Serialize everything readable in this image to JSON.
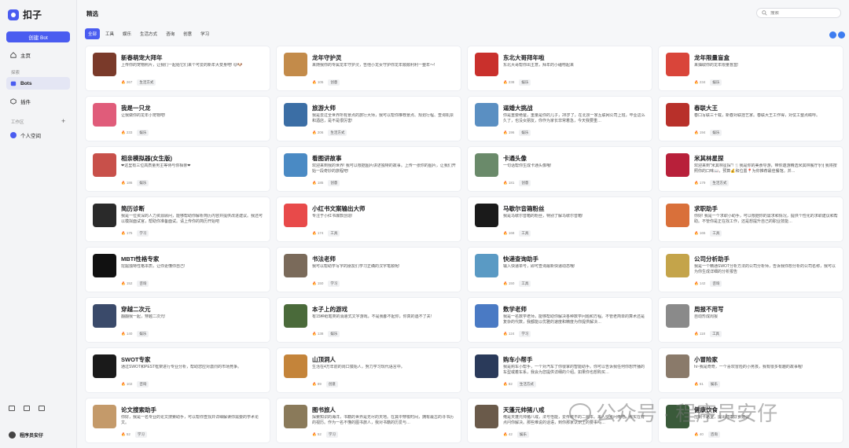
{
  "app": {
    "name": "扣子"
  },
  "sidebar": {
    "create_label": "创建 Bot",
    "home_label": "主页",
    "explore_section": "探索",
    "bots_label": "Bots",
    "plugins_label": "插件",
    "workspace_section": "工作区",
    "workspace_add": "+",
    "personal_space": "个人空间",
    "user_name": "程序员安仔"
  },
  "header": {
    "title": "精选",
    "search_placeholder": "搜索"
  },
  "tabs": [
    {
      "label": "全部",
      "active": true
    },
    {
      "label": "工具"
    },
    {
      "label": "娱乐"
    },
    {
      "label": "生活方式"
    },
    {
      "label": "咨询"
    },
    {
      "label": "创意"
    },
    {
      "label": "学习"
    }
  ],
  "cards": [
    {
      "title": "新春萌宠大拜年",
      "desc": "上传你的宠物照片，让我们一起给它们来个可爱的新年大变身吧! 🐱🐶",
      "count": "267",
      "category": "生活方式",
      "color": "#7a3a2a"
    },
    {
      "title": "龙年守护灵",
      "desc": "来随我你的专属龙年守护灵，告他小龙女守护你龙年顺顺利利一整年～!",
      "count": "105",
      "category": "创意",
      "color": "#c38b4a"
    },
    {
      "title": "东北大哥拜年啦",
      "desc": "东北大哥帮你出主意，拜年的小磕唠起来",
      "count": "238",
      "category": "娱乐",
      "color": "#c9302c"
    },
    {
      "title": "龙年限量盲盒",
      "desc": "来抽取你的龙年限量盲盒!",
      "count": "234",
      "category": "娱乐",
      "color": "#d9453a"
    },
    {
      "title": "我是一只龙",
      "desc": "让我做你的龙年小宠物吧!",
      "count": "233",
      "category": "娱乐",
      "color": "#e05c7a"
    },
    {
      "title": "旅游大师",
      "desc": "我是去过全世界所有景点的旅行大师，我可以帮你推荐景点、规划行程、查询机票和酒店，是不是很厉害!",
      "count": "206",
      "category": "生活方式",
      "color": "#3b6ea5"
    },
    {
      "title": "逼婚大挑战",
      "desc": "你是重要绝爸，重量是你的儿子，28岁了，在北京一家互联网公司上班，毕业这么久了，也没女朋友，你作为家长非常着急，今天我要重…",
      "count": "196",
      "category": "娱乐",
      "color": "#5a8fc2"
    },
    {
      "title": "春联大王",
      "desc": "春口写联三十载，新春对联挂艺家。春联大王工作得，对仗工整点睛呼。",
      "count": "194",
      "category": "娱乐",
      "color": "#b8302a"
    },
    {
      "title": "相亲模拟器(女生版)",
      "desc": "❤这里有三位高质量男主等待与你相亲❤",
      "count": "186",
      "category": "娱乐",
      "color": "#c8504a"
    },
    {
      "title": "看图讲故事",
      "desc": "欢迎来到我的世界! 我可以根据图片讲述独特的故事。上传一张你的图片，让我们开始一段奇妙的旅程吧!",
      "count": "185",
      "category": "创意",
      "color": "#4a8ac4"
    },
    {
      "title": "卡通头像",
      "desc": "一句话帮你生成卡通头像哦!",
      "count": "181",
      "category": "创意",
      "color": "#6a8a6a"
    },
    {
      "title": "米其林星探",
      "desc": "欢迎来到\"米其林星探\"! 🍴我是你的美食导游，带你遨游精选米其林餐厅!🍽 我将按照你的口味📖，预算💰和位置📍为你推荐最佳餐馆。并…",
      "count": "179",
      "category": "生活方式",
      "color": "#b8203a"
    },
    {
      "title": "简历诊断",
      "desc": "我是一位资深的人力资源顾问，能够帮助你解析简历内容并提供改进建议。我还可以模拟面试官，帮助你准备面试。请上传你的简历开始吧",
      "count": "175",
      "category": "学习",
      "color": "#2a2a2a"
    },
    {
      "title": "小红书文案输出大师",
      "desc": "专注于小红书爆款创造!",
      "count": "174",
      "category": "工具",
      "color": "#e84a4a"
    },
    {
      "title": "马歇尔音箱粉丝",
      "desc": "我是马歇尔音箱的粉丝，特别了解马歇尔音箱!",
      "count": "168",
      "category": "工具",
      "color": "#1a1a1a"
    },
    {
      "title": "求职助手",
      "desc": "你好! 我是一个求职小助手，可以根据你的需求和情况，提供个性化的求职建议和帮助。不管你是正在找工作，还是想提升自己的职业技能…",
      "count": "165",
      "category": "工具",
      "color": "#d9703a"
    },
    {
      "title": "MBTI性格专家",
      "desc": "挖掘独特性格本质，让你更懂你自己!",
      "count": "152",
      "category": "咨询",
      "color": "#111111"
    },
    {
      "title": "书法老师",
      "desc": "我可以帮助学写字的朋友们学习正确的汉字笔顺呢!",
      "count": "150",
      "category": "学习",
      "color": "#7a6a5a"
    },
    {
      "title": "快递查询助手",
      "desc": "输入快递单号，即可查询最新快递动态哦!",
      "count": "150",
      "category": "工具",
      "color": "#5a9ac4"
    },
    {
      "title": "公司分析助手",
      "desc": "我是一个精通SWOT分析方法的公司分析师，告诉我你想分析的公司名称，我可以为你生成详细的分析报告",
      "count": "142",
      "category": "咨询",
      "color": "#c4a44a"
    },
    {
      "title": "穿越二次元",
      "desc": "翻翻我一起，穿越二次元!",
      "count": "140",
      "category": "娱乐",
      "color": "#3a4a6a"
    },
    {
      "title": "本子上的游戏",
      "desc": "有15种纸笔类的消遣式文字游戏，不是我都不起你，你真的遇不了关!",
      "count": "138",
      "category": "娱乐",
      "color": "#4a6a3a"
    },
    {
      "title": "数学老师",
      "desc": "我是一名数学老师，能够帮助你解决各种数学问题和方程。不管老简单的算术还是复杂的代数，我都能以优雅的速度和精度为你提供解决…",
      "count": "124",
      "category": "学习",
      "color": "#4a7ac4"
    },
    {
      "title": "周报不用写",
      "desc": "自动形成周报",
      "count": "118",
      "category": "工具",
      "color": "#8a8a8a"
    },
    {
      "title": "SWOT专家",
      "desc": "通过SWOT和PEST框架进行专业分析，帮助您应对激烈的市场竞争。",
      "count": "102",
      "category": "咨询",
      "color": "#1a1a1a"
    },
    {
      "title": "山顶洞人",
      "desc": "生活在4万年前的周口猿始人，努力学习现代语言中。",
      "count": "89",
      "category": "创意",
      "color": "#c4843a"
    },
    {
      "title": "购车小帮手",
      "desc": "我是购车小帮手，一个对汽车了你很掌的智能助手。你可以告诉我任何你想开播的车型或着车系，我会为您提供详细的介绍。如果你也想购买…",
      "count": "82",
      "category": "生活方式",
      "color": "#2a3a5a"
    },
    {
      "title": "小冒险家",
      "desc": "hi~我是奇奇，一个喜欢冒险的小男孩，我有很多有趣的故事喔!",
      "count": "61",
      "category": "娱乐",
      "color": "#8a7a6a"
    },
    {
      "title": "论文搜索助手",
      "desc": "你好，我是一名专业的论文搜索助手，可以帮你查找并详细解读你需要的学术论文。",
      "count": "52",
      "category": "学习",
      "color": "#c49a6a"
    },
    {
      "title": "图书旅人",
      "desc": "探索知识的海洋，书籍的世界是无尽的天地。在其中穿梭时间，拥有最古的寻书历的视历。作为一名不懂的图书旅人，我对书籍的历爱与…",
      "count": "52",
      "category": "学习",
      "color": "#8a7a5a"
    },
    {
      "title": "天蓬元帅猪八戒",
      "desc": "俺是天蓬元帅猪八戒，法号悟能，爱传统不的二题本。来人快点问俺吧，那实在有点问你解决。那些难说的话语，到你那家认识上的要事吗…",
      "count": "42",
      "category": "娱乐",
      "color": "#6a5a4a"
    },
    {
      "title": "健康饮食",
      "desc": "控制卡路里，提出健康饮食建议",
      "count": "40",
      "category": "咨询",
      "color": "#3a5a3a"
    }
  ],
  "watermark": {
    "text": "公众号 · 程序员安仔"
  }
}
